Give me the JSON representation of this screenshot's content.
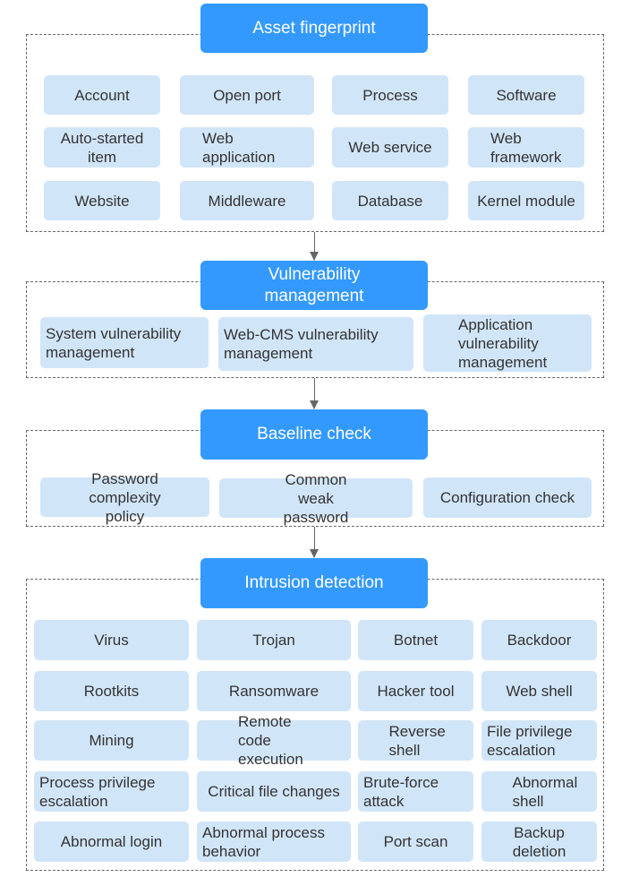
{
  "colors": {
    "header": "#3399ff",
    "item": "#d1e5f8",
    "text": "#333333",
    "border": "#666666"
  },
  "sections": [
    {
      "title": "Asset fingerprint",
      "items": [
        "Account",
        "Open port",
        "Process",
        "Software",
        "Auto-started item",
        "Web application",
        "Web service",
        "Web framework",
        "Website",
        "Middleware",
        "Database",
        "Kernel module"
      ]
    },
    {
      "title": "Vulnerability management",
      "items": [
        "System vulnerability management",
        "Web-CMS vulnerability management",
        "Application vulnerability management"
      ]
    },
    {
      "title": "Baseline check",
      "items": [
        "Password complexity policy",
        "Common weak password",
        "Configuration check"
      ]
    },
    {
      "title": "Intrusion detection",
      "items": [
        "Virus",
        "Trojan",
        "Botnet",
        "Backdoor",
        "Rootkits",
        "Ransomware",
        "Hacker tool",
        "Web shell",
        "Mining",
        "Remote code execution",
        "Reverse shell",
        "File privilege escalation",
        "Process privilege escalation",
        "Critical file changes",
        "Brute-force attack",
        "Abnormal shell",
        "Abnormal login",
        "Abnormal process behavior",
        "Port scan",
        "Backup deletion"
      ]
    }
  ]
}
